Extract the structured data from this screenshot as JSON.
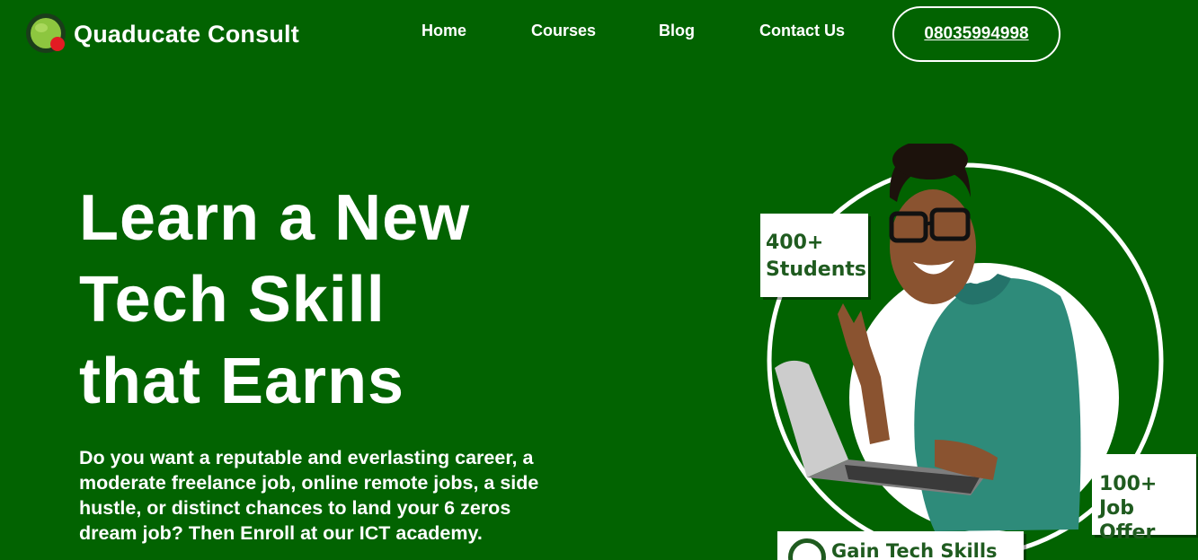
{
  "brand": {
    "name": "Quaducate Consult",
    "logo_icon": "green-ball-logo-icon",
    "logo_colors": {
      "ball": "#8dc63f",
      "ring": "#1a3d1a",
      "dot": "#e31b23"
    }
  },
  "nav": {
    "items": [
      {
        "label": "Home"
      },
      {
        "label": "Courses"
      },
      {
        "label": "Blog"
      },
      {
        "label": "Contact Us"
      }
    ],
    "phone": "08035994998"
  },
  "hero": {
    "headline_lines": [
      "Learn a New",
      "Tech Skill",
      "that Earns"
    ],
    "description": "Do you want a reputable and everlasting career, a moderate freelance job, online remote jobs, a side hustle, or distinct chances to land your 6 zeros dream job? Then Enroll at our ICT academy."
  },
  "badges": {
    "students": {
      "line1": "400+",
      "line2": "Students"
    },
    "jobs": {
      "line1": "100+",
      "line2": "Job Offer"
    },
    "skills": {
      "text": "Gain Tech Skills"
    }
  },
  "colors": {
    "background": "#026301",
    "text": "#ffffff",
    "badge_text": "#1f5b1f",
    "shirt": "#2e8b7a"
  }
}
